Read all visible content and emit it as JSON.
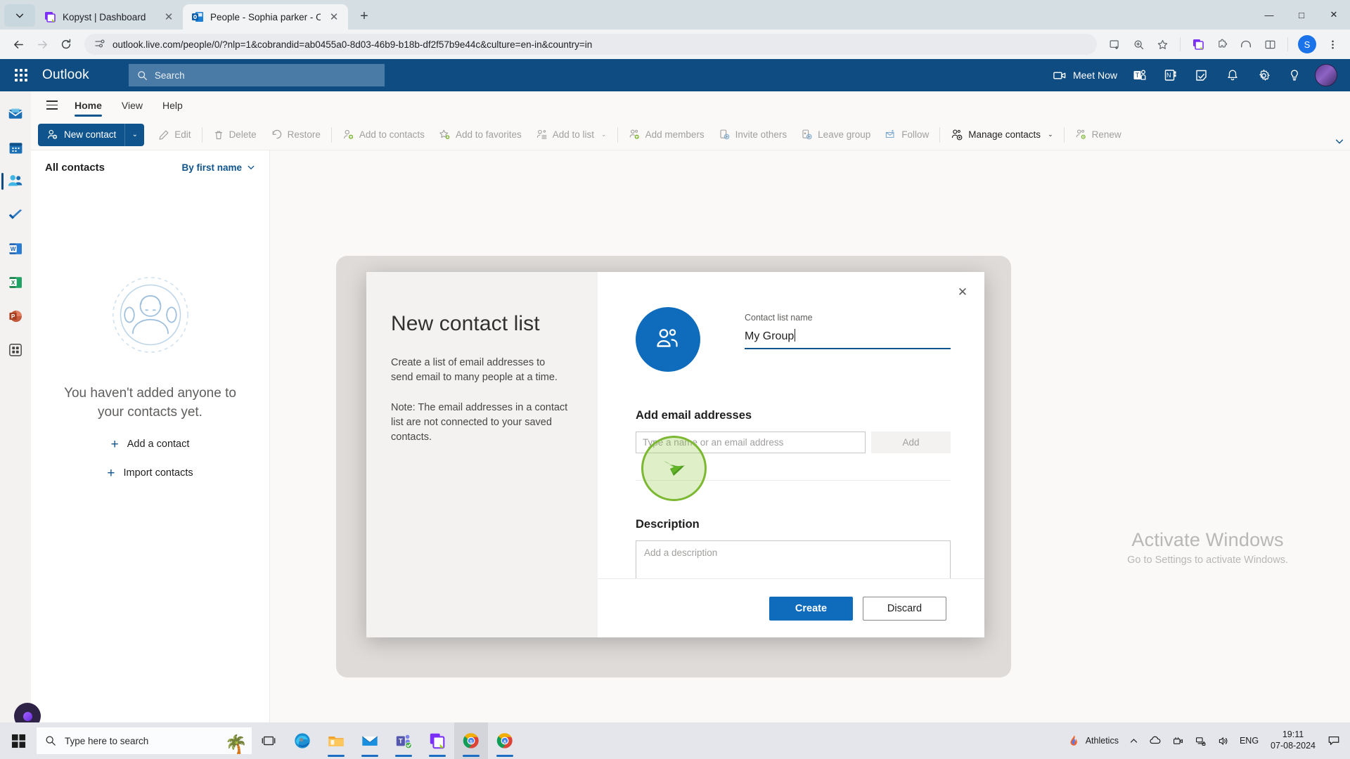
{
  "browser": {
    "tabs": [
      {
        "title": "Kopyst | Dashboard",
        "favicon": "kopyst-icon",
        "active": false
      },
      {
        "title": "People - Sophia parker - Outloo",
        "favicon": "outlook-icon",
        "active": true
      }
    ],
    "new_tab_label": "+",
    "window_controls": {
      "minimize": "—",
      "maximize": "□",
      "close": "✕"
    },
    "url": "outlook.live.com/people/0/?nlp=1&cobrandid=ab0455a0-8d03-46b9-b18b-df2f57b9e44c&culture=en-in&country=in",
    "profile_initial": "S",
    "nav": {
      "back": "back-arrow-icon",
      "forward": "forward-arrow-icon",
      "reload": "reload-icon",
      "site_info": "site-settings-icon"
    },
    "omnibox_icons": [
      "install-app-icon",
      "zoom-icon",
      "bookmark-star-icon",
      "kopyst-extension-icon",
      "extension-icon",
      "media-icon",
      "split-screen-icon"
    ],
    "menu_icon": "kebab-menu-icon"
  },
  "outlook": {
    "brand": "Outlook",
    "waffle": "app-launcher-icon",
    "search": {
      "placeholder": "Search",
      "icon": "search-icon"
    },
    "header_actions": [
      {
        "name": "meet-now",
        "label": "Meet Now",
        "icon": "video-camera-icon"
      },
      {
        "name": "teams",
        "label": "",
        "icon": "teams-icon"
      },
      {
        "name": "onenote",
        "label": "",
        "icon": "onenote-icon"
      },
      {
        "name": "notes",
        "label": "",
        "icon": "notes-icon"
      },
      {
        "name": "notifications",
        "label": "",
        "icon": "bell-icon"
      },
      {
        "name": "settings",
        "label": "",
        "icon": "gear-icon"
      },
      {
        "name": "tips",
        "label": "",
        "icon": "lightbulb-icon"
      }
    ],
    "app_rail": [
      {
        "name": "mail",
        "icon": "mail-icon",
        "active": false
      },
      {
        "name": "calendar",
        "icon": "calendar-icon",
        "active": false
      },
      {
        "name": "people",
        "icon": "people-icon",
        "active": true
      },
      {
        "name": "to-do",
        "icon": "check-icon",
        "active": false
      },
      {
        "name": "word",
        "icon": "word-icon",
        "active": false
      },
      {
        "name": "excel",
        "icon": "excel-icon",
        "active": false
      },
      {
        "name": "powerpoint",
        "icon": "powerpoint-icon",
        "active": false
      },
      {
        "name": "all-apps",
        "icon": "grid-apps-icon",
        "active": false
      }
    ],
    "ribbon_tabs": [
      {
        "label": "Home",
        "active": true
      },
      {
        "label": "View",
        "active": false
      },
      {
        "label": "Help",
        "active": false
      }
    ],
    "ribbon": {
      "primary": {
        "label": "New contact",
        "icon": "person-add-icon",
        "caret": "⌄"
      },
      "items": [
        {
          "label": "Edit",
          "icon": "pencil-icon",
          "enabled": false,
          "caret": ""
        },
        {
          "label": "Delete",
          "icon": "trash-icon",
          "enabled": false,
          "caret": ""
        },
        {
          "label": "Restore",
          "icon": "undo-icon",
          "enabled": false,
          "caret": ""
        },
        {
          "label": "Add to contacts",
          "icon": "person-add-icon",
          "enabled": false,
          "caret": ""
        },
        {
          "label": "Add to favorites",
          "icon": "star-add-icon",
          "enabled": false,
          "caret": ""
        },
        {
          "label": "Add to list",
          "icon": "list-add-icon",
          "enabled": false,
          "caret": "⌄"
        },
        {
          "label": "Add members",
          "icon": "people-add-icon",
          "enabled": false,
          "caret": ""
        },
        {
          "label": "Invite others",
          "icon": "invite-icon",
          "enabled": false,
          "caret": ""
        },
        {
          "label": "Leave group",
          "icon": "leave-group-icon",
          "enabled": false,
          "caret": ""
        },
        {
          "label": "Follow",
          "icon": "follow-envelope-icon",
          "enabled": false,
          "caret": ""
        },
        {
          "label": "Manage contacts",
          "icon": "manage-contacts-icon",
          "enabled": true,
          "caret": "⌄"
        },
        {
          "label": "Renew",
          "icon": "renew-icon",
          "enabled": false,
          "caret": ""
        }
      ],
      "expand_icon": "chevron-down-icon"
    },
    "contacts_pane": {
      "title": "All contacts",
      "sort_label": "By first name",
      "sort_caret": "⌄",
      "empty_line1": "You haven't added anyone to",
      "empty_line2": "your contacts yet.",
      "links": [
        {
          "label": "Add a contact",
          "icon": "plus-icon"
        },
        {
          "label": "Import contacts",
          "icon": "plus-icon"
        }
      ]
    }
  },
  "dialog": {
    "close_label": "✕",
    "heading": "New contact list",
    "paragraph1": "Create a list of email addresses to send email to many people at a time.",
    "paragraph2": "Note: The email addresses in a contact list are not connected to your saved contacts.",
    "avatar_icon": "people-group-icon",
    "name_label": "Contact list name",
    "name_value": "My Group",
    "email_section_title": "Add email addresses",
    "email_placeholder": "Type a name or an email address",
    "add_button": "Add",
    "description_title": "Description",
    "description_placeholder": "Add a description",
    "create_button": "Create",
    "discard_button": "Discard"
  },
  "watermark": {
    "line1": "Activate Windows",
    "line2": "Go to Settings to activate Windows."
  },
  "taskbar": {
    "start_icon": "windows-start-icon",
    "search_placeholder": "Type here to search",
    "search_icon": "search-icon",
    "weather_icon": "beach-icon",
    "pinned": [
      {
        "name": "task-view",
        "icon": "task-view-icon",
        "open": false
      },
      {
        "name": "edge",
        "icon": "edge-icon",
        "open": false
      },
      {
        "name": "file-explorer",
        "icon": "folder-icon",
        "open": true
      },
      {
        "name": "mail",
        "icon": "mail-app-icon",
        "open": true
      },
      {
        "name": "teams",
        "icon": "teams-app-icon",
        "open": true
      },
      {
        "name": "kopyst",
        "icon": "kopyst-app-icon",
        "open": true
      },
      {
        "name": "chrome-s",
        "icon": "chrome-icon",
        "open": true
      },
      {
        "name": "chrome-a",
        "icon": "chrome-icon",
        "open": true
      }
    ],
    "tray": {
      "app_label": "Athletics",
      "app_icon": "flame-icon",
      "chevron": "∧",
      "icons": [
        "cloud-icon",
        "camera-icon",
        "network-icon",
        "volume-icon"
      ],
      "language": "ENG",
      "time": "19:11",
      "date": "07-08-2024",
      "action_center": "notification-icon"
    }
  },
  "colors": {
    "outlook_header": "#0f4c82",
    "accent_blue": "#0f6cbd",
    "ribbon_primary": "#0f548c",
    "cursor_green": "#7cb832"
  }
}
